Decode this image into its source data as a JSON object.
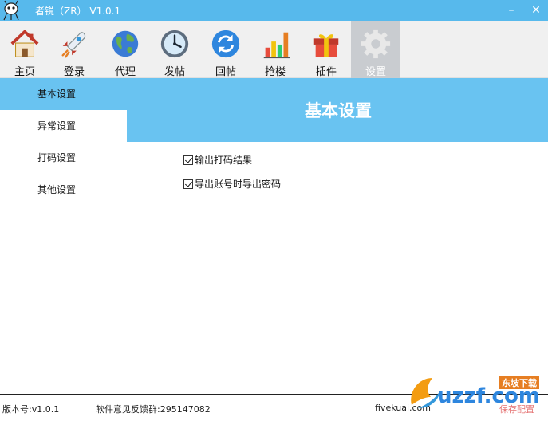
{
  "window": {
    "title": "者锐（ZR）  V1.0.1",
    "minimize_glyph": "–",
    "close_glyph": "✕"
  },
  "toolbar": {
    "items": [
      {
        "label": "主页",
        "icon": "home-icon"
      },
      {
        "label": "登录",
        "icon": "rocket-icon"
      },
      {
        "label": "代理",
        "icon": "globe-icon"
      },
      {
        "label": "发帖",
        "icon": "clock-icon"
      },
      {
        "label": "回帖",
        "icon": "refresh-icon"
      },
      {
        "label": "抢楼",
        "icon": "bar-chart-icon"
      },
      {
        "label": "插件",
        "icon": "gift-icon"
      },
      {
        "label": "设置",
        "icon": "gear-icon"
      }
    ],
    "active_index": 7
  },
  "nav": {
    "items": [
      "基本设置",
      "异常设置",
      "打码设置",
      "其他设置"
    ],
    "active_index": 0
  },
  "panel": {
    "title": "基本设置",
    "options": [
      {
        "label": "输出打码结果",
        "checked": true
      },
      {
        "label": "导出账号时导出密码",
        "checked": true
      }
    ]
  },
  "statusbar": {
    "version": "版本号:v1.0.1",
    "feedback": "软件意见反馈群:295147082",
    "site": "fivekuai.com",
    "save": "保存配置"
  },
  "watermark": {
    "brand": "uzzf.com",
    "tag": "东坡下载"
  },
  "colors": {
    "titlebar": "#57b9ec",
    "accent": "#69c3f1",
    "toolbar_bg": "#f0f0f0",
    "active_tool": "#c9ccd0"
  }
}
